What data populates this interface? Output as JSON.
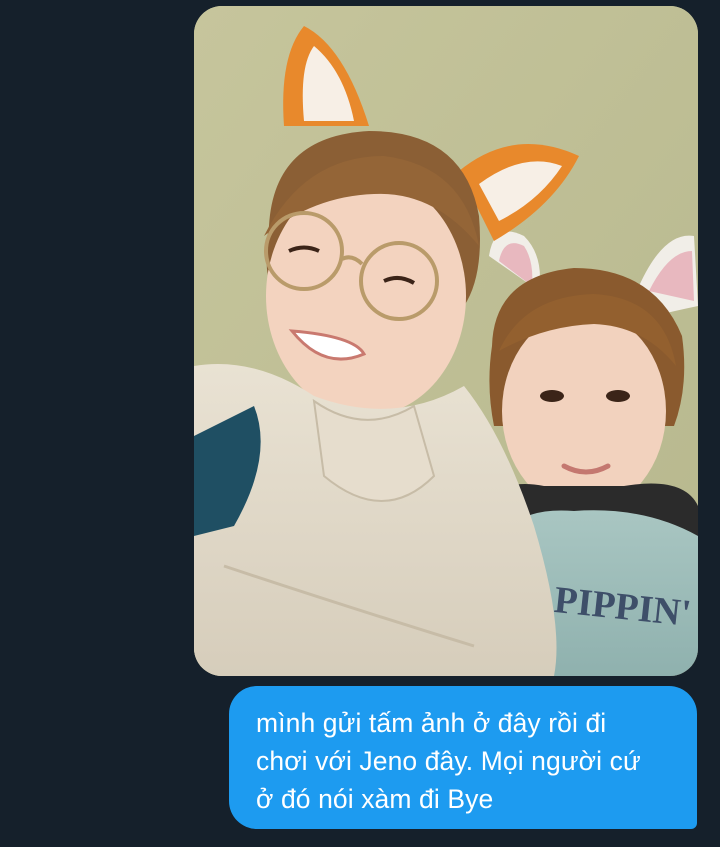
{
  "conversation": {
    "messages": [
      {
        "type": "image",
        "content": "photo-two-people-animal-ears-headbands",
        "image_text": "PIPPIN'"
      },
      {
        "type": "text",
        "lines": [
          "mình gửi tấm ảnh ở đây rồi đi",
          "chơi với Jeno đây. Mọi người cứ",
          "ở đó nói xàm đi Bye"
        ]
      }
    ]
  },
  "colors": {
    "background": "#15202b",
    "outgoing_bubble": "#1d9bf0",
    "bubble_text": "#ffffff"
  }
}
